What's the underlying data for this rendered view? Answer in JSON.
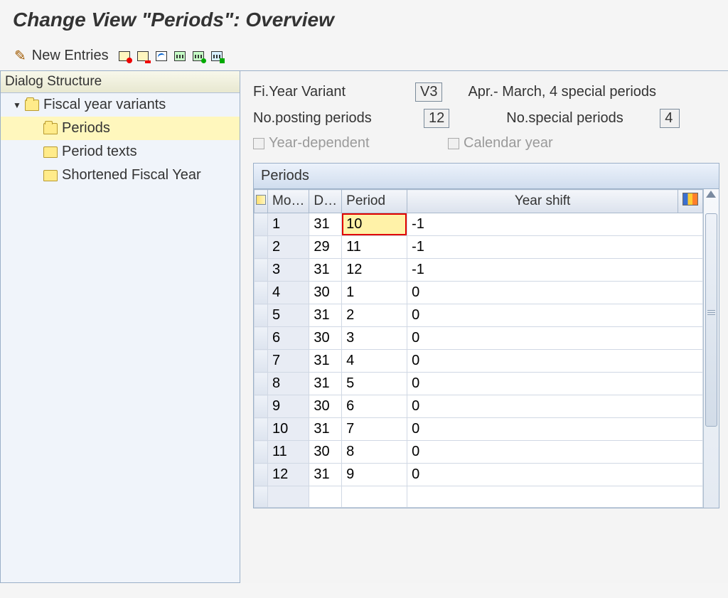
{
  "header": {
    "title": "Change View \"Periods\": Overview"
  },
  "toolbar": {
    "new_entries": "New Entries"
  },
  "tree": {
    "title": "Dialog Structure",
    "root": "Fiscal year variants",
    "children": [
      "Periods",
      "Period texts",
      "Shortened Fiscal Year"
    ],
    "selected_index": 0
  },
  "detail": {
    "variant_label": "Fi.Year Variant",
    "variant_code": "V3",
    "variant_desc": "Apr.- March, 4 special periods",
    "posting_label": "No.posting periods",
    "posting_value": "12",
    "special_label": "No.special periods",
    "special_value": "4",
    "year_dep_label": "Year-dependent",
    "cal_year_label": "Calendar year"
  },
  "table": {
    "title": "Periods",
    "headers": {
      "month": "Mo…",
      "day": "D…",
      "period": "Period",
      "yearshift": "Year shift"
    },
    "selected_row": 0,
    "rows": [
      {
        "month": "1",
        "day": "31",
        "period": "10",
        "yearshift": "-1"
      },
      {
        "month": "2",
        "day": "29",
        "period": "11",
        "yearshift": "-1"
      },
      {
        "month": "3",
        "day": "31",
        "period": "12",
        "yearshift": "-1"
      },
      {
        "month": "4",
        "day": "30",
        "period": "1",
        "yearshift": "0"
      },
      {
        "month": "5",
        "day": "31",
        "period": "2",
        "yearshift": "0"
      },
      {
        "month": "6",
        "day": "30",
        "period": "3",
        "yearshift": "0"
      },
      {
        "month": "7",
        "day": "31",
        "period": "4",
        "yearshift": "0"
      },
      {
        "month": "8",
        "day": "31",
        "period": "5",
        "yearshift": "0"
      },
      {
        "month": "9",
        "day": "30",
        "period": "6",
        "yearshift": "0"
      },
      {
        "month": "10",
        "day": "31",
        "period": "7",
        "yearshift": "0"
      },
      {
        "month": "11",
        "day": "30",
        "period": "8",
        "yearshift": "0"
      },
      {
        "month": "12",
        "day": "31",
        "period": "9",
        "yearshift": "0"
      }
    ]
  }
}
